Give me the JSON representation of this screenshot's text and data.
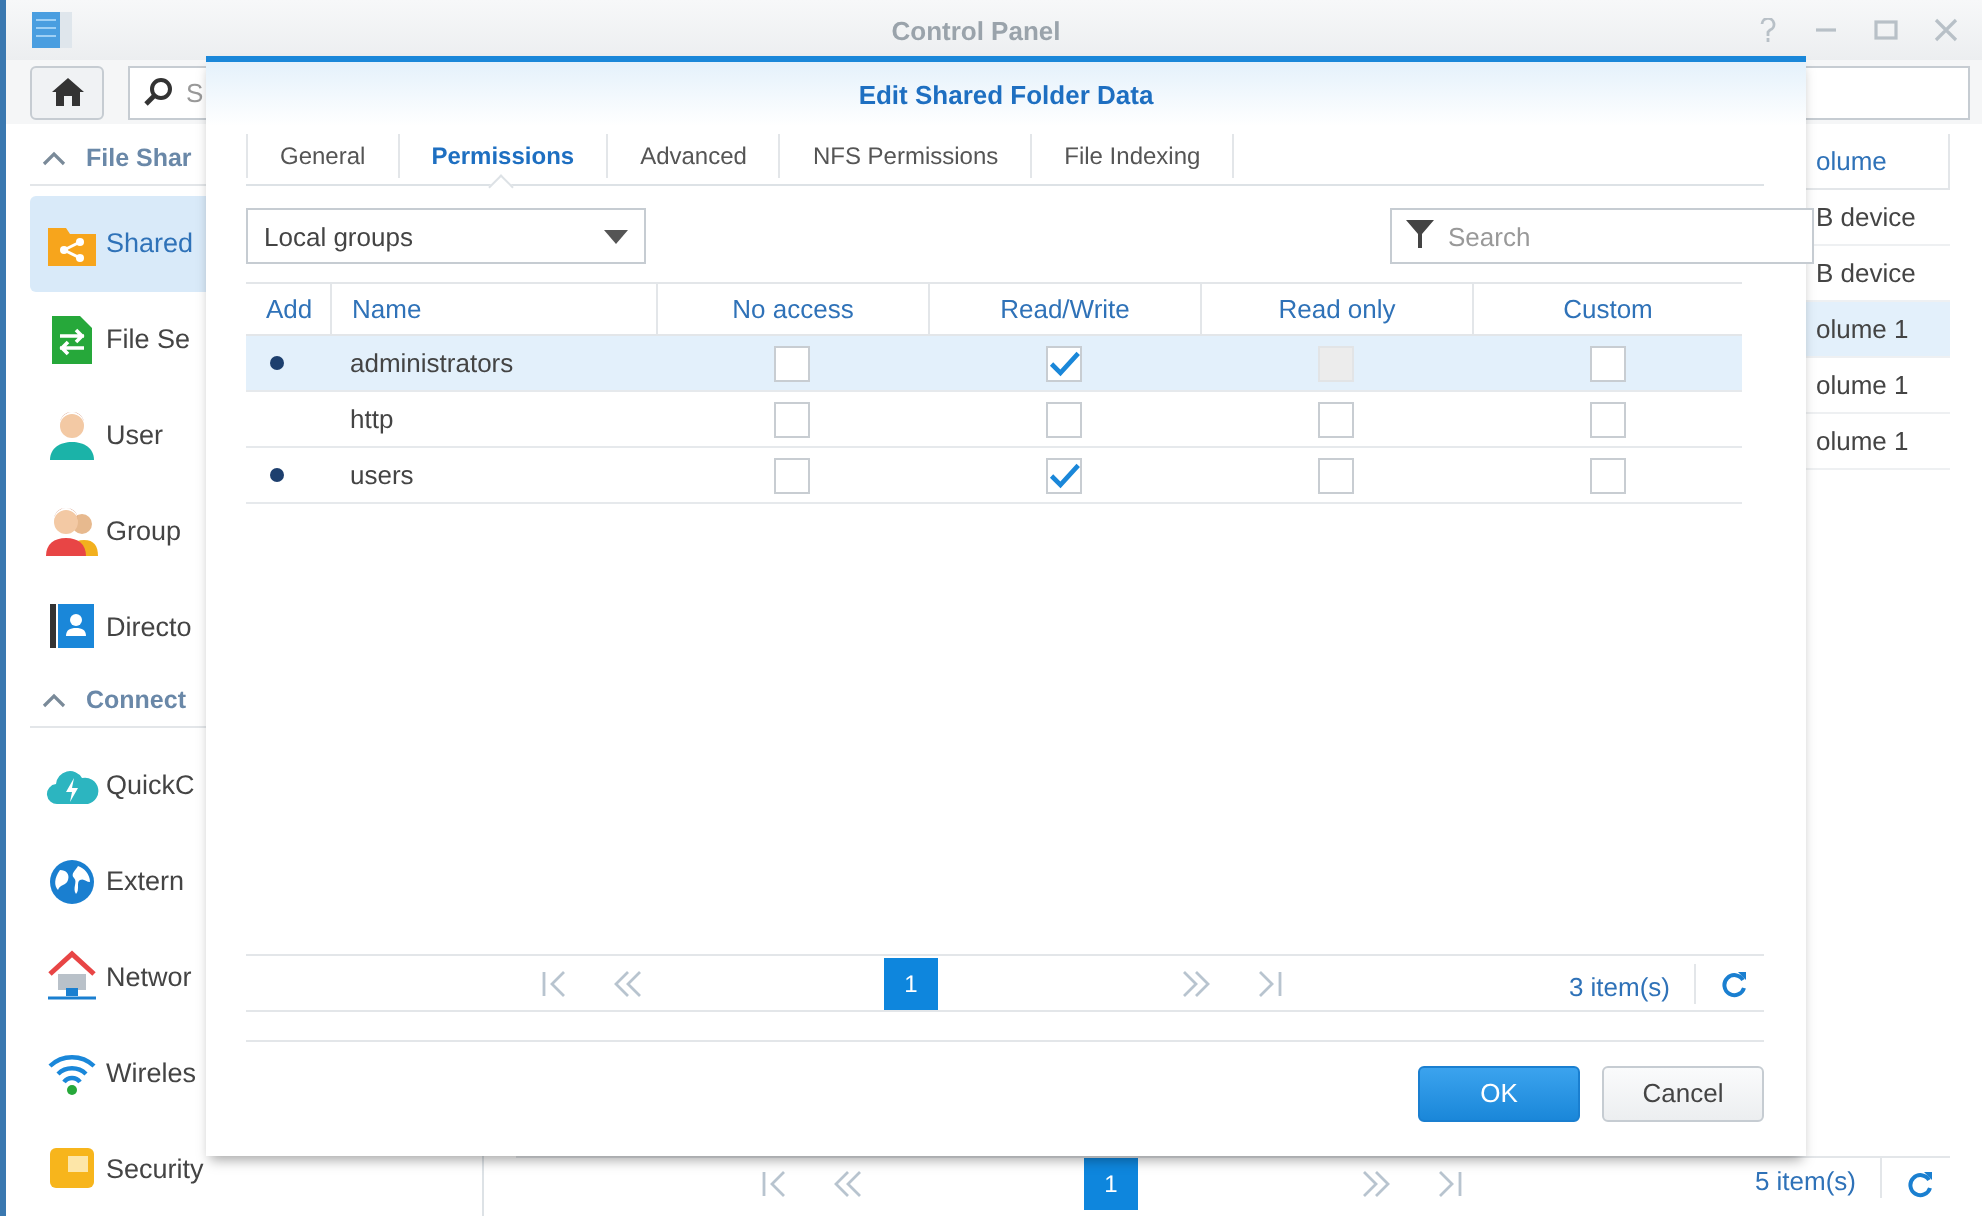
{
  "window": {
    "title": "Control Panel"
  },
  "toolbar": {
    "search": {
      "placeholder": "S"
    }
  },
  "sidebar": {
    "sections": [
      {
        "label": "File Shar",
        "expanded": true,
        "items": [
          {
            "label": "Shared",
            "selected": true
          },
          {
            "label": "File Se",
            "selected": false
          },
          {
            "label": "User",
            "selected": false
          },
          {
            "label": "Group",
            "selected": false
          },
          {
            "label": "Directo",
            "selected": false
          }
        ]
      },
      {
        "label": "Connect",
        "expanded": true,
        "items": [
          {
            "label": "QuickC",
            "selected": false
          },
          {
            "label": "Extern",
            "selected": false
          },
          {
            "label": "Networ",
            "selected": false
          },
          {
            "label": "Wireles",
            "selected": false
          },
          {
            "label": "Security",
            "selected": false
          }
        ]
      }
    ]
  },
  "table": {
    "columns": [
      "olume"
    ],
    "rows": [
      {
        "cells": [
          "B device"
        ],
        "selected": false
      },
      {
        "cells": [
          "B device"
        ],
        "selected": false
      },
      {
        "cells": [
          "olume 1"
        ],
        "selected": true
      },
      {
        "cells": [
          "olume 1"
        ],
        "selected": false
      },
      {
        "cells": [
          "olume 1"
        ],
        "selected": false
      }
    ]
  },
  "pager": {
    "pages": [
      {
        "label": "1",
        "selected": true
      }
    ],
    "count": "5 item(s)"
  },
  "dialog": {
    "title": "Edit Shared Folder Data",
    "tabs": [
      {
        "label": "General",
        "selected": false
      },
      {
        "label": "Permissions",
        "selected": true
      },
      {
        "label": "Advanced",
        "selected": false
      },
      {
        "label": "NFS Permissions",
        "selected": false
      },
      {
        "label": "File Indexing",
        "selected": false
      }
    ],
    "filter": {
      "value": "Local groups"
    },
    "search": {
      "placeholder": "Search"
    },
    "table": {
      "columns": [
        "Add",
        "Name",
        "No access",
        "Read/Write",
        "Read only",
        "Custom"
      ],
      "rows": [
        {
          "name": "administrators",
          "added": true,
          "selected": true,
          "permissions": [
            {
              "checked": false,
              "disabled": false
            },
            {
              "checked": true,
              "disabled": false
            },
            {
              "checked": false,
              "disabled": true
            },
            {
              "checked": false,
              "disabled": false
            }
          ]
        },
        {
          "name": "http",
          "added": false,
          "selected": false,
          "permissions": [
            {
              "checked": false,
              "disabled": false
            },
            {
              "checked": false,
              "disabled": false
            },
            {
              "checked": false,
              "disabled": false
            },
            {
              "checked": false,
              "disabled": false
            }
          ]
        },
        {
          "name": "users",
          "added": true,
          "selected": false,
          "permissions": [
            {
              "checked": false,
              "disabled": false
            },
            {
              "checked": true,
              "disabled": false
            },
            {
              "checked": false,
              "disabled": false
            },
            {
              "checked": false,
              "disabled": false
            }
          ]
        }
      ]
    },
    "pager": {
      "pages": [
        {
          "label": "1",
          "selected": true
        }
      ],
      "count": "3 item(s)"
    },
    "buttons": [
      {
        "label": "OK",
        "kind": "primary"
      },
      {
        "label": "Cancel",
        "kind": "secondary"
      }
    ]
  }
}
